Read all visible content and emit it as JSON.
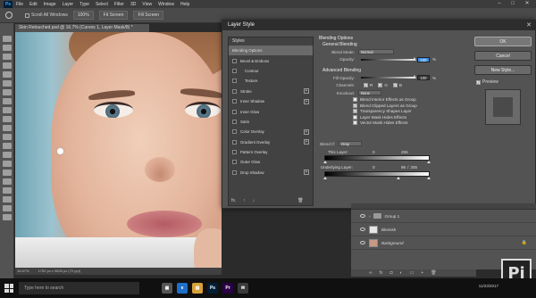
{
  "menubar": {
    "app_icon": "Ps",
    "items": [
      "File",
      "Edit",
      "Image",
      "Layer",
      "Type",
      "Select",
      "Filter",
      "3D",
      "View",
      "Window",
      "Help"
    ],
    "window_controls": [
      "–",
      "□",
      "✕"
    ]
  },
  "optionsbar": {
    "scroll_all_label": "Scroll All Windows",
    "btn_100": "100%",
    "btn_fit": "Fit Screen",
    "btn_fill": "Fill Screen"
  },
  "document": {
    "tab_title": "Skin Retouched.psd @ 16.7% (Curves 1, Layer Mask/8) *",
    "zoom": "16.67%",
    "doc_info": "1792 px x 3600 px (72 ppi)"
  },
  "dialog": {
    "title": "Layer Style",
    "styles_header": "Styles",
    "styles": [
      {
        "label": "Blending Options",
        "checkbox": false,
        "plus": false,
        "selected": true
      },
      {
        "label": "Bevel & Emboss",
        "checkbox": true,
        "plus": false,
        "selected": false
      },
      {
        "label": "Contour",
        "checkbox": true,
        "plus": false,
        "selected": false
      },
      {
        "label": "Texture",
        "checkbox": true,
        "plus": false,
        "selected": false
      },
      {
        "label": "Stroke",
        "checkbox": true,
        "plus": true,
        "selected": false
      },
      {
        "label": "Inner Shadow",
        "checkbox": true,
        "plus": true,
        "selected": false
      },
      {
        "label": "Inner Glow",
        "checkbox": true,
        "plus": false,
        "selected": false
      },
      {
        "label": "Satin",
        "checkbox": true,
        "plus": false,
        "selected": false
      },
      {
        "label": "Color Overlay",
        "checkbox": true,
        "plus": true,
        "selected": false
      },
      {
        "label": "Gradient Overlay",
        "checkbox": true,
        "plus": true,
        "selected": false
      },
      {
        "label": "Pattern Overlay",
        "checkbox": true,
        "plus": false,
        "selected": false
      },
      {
        "label": "Outer Glow",
        "checkbox": true,
        "plus": false,
        "selected": false
      },
      {
        "label": "Drop Shadow",
        "checkbox": true,
        "plus": true,
        "selected": false
      }
    ],
    "footer": [
      "fx.",
      "↑",
      "↓",
      "🗑"
    ],
    "blending": {
      "title": "Blending Options",
      "general_title": "General Blending",
      "blend_mode_label": "Blend Mode:",
      "blend_mode_value": "Normal",
      "opacity_label": "Opacity:",
      "opacity_value": "100",
      "opacity_unit": "%",
      "advanced_title": "Advanced Blending",
      "fill_opacity_label": "Fill Opacity:",
      "fill_opacity_value": "100",
      "fill_opacity_unit": "%",
      "channels_label": "Channels:",
      "channels": [
        "R",
        "G",
        "B"
      ],
      "knockout_label": "Knockout:",
      "knockout_value": "None",
      "options": [
        {
          "label": "Blend Interior Effects as Group",
          "checked": false
        },
        {
          "label": "Blend Clipped Layers as Group",
          "checked": true
        },
        {
          "label": "Transparency Shapes Layer",
          "checked": true
        },
        {
          "label": "Layer Mask Hides Effects",
          "checked": false
        },
        {
          "label": "Vector Mask Hides Effects",
          "checked": false
        }
      ],
      "blend_if_label": "Blend If:",
      "blend_if_value": "Gray",
      "this_layer_label": "This Layer:",
      "this_layer_low": "0",
      "this_layer_high": "255",
      "underlying_label": "Underlying Layer:",
      "underlying_low": "0",
      "underlying_mid": "96",
      "underlying_slash": "/",
      "underlying_high": "255"
    },
    "buttons": {
      "ok": "OK",
      "cancel": "Cancel",
      "new_style": "New Style..."
    },
    "preview_label": "Preview"
  },
  "layers": [
    {
      "name": "Group 1",
      "type": "group"
    },
    {
      "name": "Blemish",
      "type": "pixel"
    },
    {
      "name": "Background",
      "type": "background"
    }
  ],
  "taskbar": {
    "search_placeholder": "Type here to search",
    "apps": [
      {
        "label": "▣",
        "color": "#555555"
      },
      {
        "label": "e",
        "color": "#1e6fc8"
      },
      {
        "label": "▤",
        "color": "#d8a23a"
      },
      {
        "label": "Ps",
        "color": "#001e36"
      },
      {
        "label": "Pr",
        "color": "#2a0047"
      },
      {
        "label": "✉",
        "color": "#3b3b3b"
      }
    ],
    "date": "11/23/2017"
  },
  "watermark": "Pi",
  "colors": {
    "accent": "#3b8ee6",
    "dialog_bg": "#535353"
  }
}
